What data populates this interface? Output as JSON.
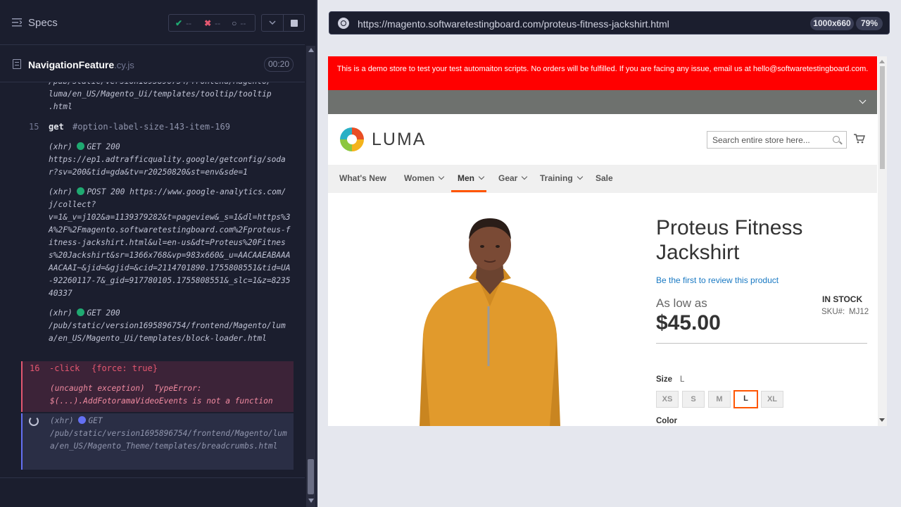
{
  "reporter": {
    "specs_label": "Specs",
    "stats": {
      "passed": "--",
      "failed": "--",
      "pending": "--"
    },
    "spec_file": {
      "name": "NavigationFeature",
      "ext": ".cy.js",
      "duration": "00:20"
    },
    "log": {
      "top_fragment": "/pub/static/version1695896754/frontend/Magento/\nluma/en_US/Magento_Ui/templates/tooltip/tooltip\n.html",
      "cmd15": {
        "num": "15",
        "name": "get",
        "arg": "#option-label-size-143-item-169"
      },
      "xhr1": {
        "prefix": "(xhr)",
        "method": "GET",
        "status": "200",
        "url": "https://ep1.adtrafficquality.google/getconfig/sodar?sv=200&tid=gda&tv=r20250820&st=env&sde=1"
      },
      "xhr2": {
        "prefix": "(xhr)",
        "method": "POST",
        "status": "200",
        "url": "https://www.google-analytics.com/j/collect?\nv=1&_v=j102&a=1139379282&t=pageview&_s=1&dl=https%3A%2F%2Fmagento.softwaretestingboard.com%2Fproteus-fitness-jackshirt.html&ul=en-us&dt=Proteus%20Fitness%20Jackshirt&sr=1366x768&vp=983x660&_u=AACAAEABAAAAACAAI~&jid=&gjid=&cid=2114701890.1755808551&tid=UA-92260117-7&_gid=917780105.1755808551&_slc=1&z=823540337"
      },
      "xhr3": {
        "prefix": "(xhr)",
        "method": "GET",
        "status": "200",
        "url": "/pub/static/version1695896754/frontend/Magento/luma/en_US/Magento_Ui/templates/block-loader.html"
      },
      "cmd16": {
        "num": "16",
        "name": "-click",
        "arg": "{force: true}"
      },
      "error": "(uncaught exception)  TypeError:\n$(...).AddFotoramaVideoEvents is not a function",
      "xhr4": {
        "prefix": "(xhr)",
        "method": "GET",
        "url": "/pub/static/version1695896754/frontend/Magento/luma/en_US/Magento_Theme/templates/breadcrumbs.html"
      }
    }
  },
  "aut": {
    "url": "https://magento.softwaretestingboard.com/proteus-fitness-jackshirt.html",
    "viewport": "1000x660",
    "zoom": "79%",
    "site": {
      "demo_banner": "This is a demo store to test your test automaiton scripts. No orders will be fulfilled. If you are facing any issue, email us at hello@softwaretestingboard.com.",
      "logo_text": "LUMA",
      "search_placeholder": "Search entire store here...",
      "nav": [
        "What's New",
        "Women",
        "Men",
        "Gear",
        "Training",
        "Sale"
      ],
      "product": {
        "title": "Proteus Fitness Jackshirt",
        "review_link": "Be the first to review this product",
        "stock": "IN STOCK",
        "as_low_as": "As low as",
        "price": "$45.00",
        "sku_label": "SKU#:",
        "sku": "MJ12",
        "size_label": "Size",
        "size_value": "L",
        "sizes": [
          "XS",
          "S",
          "M",
          "L",
          "XL"
        ],
        "selected_size": "L",
        "color_label": "Color"
      }
    }
  },
  "colors": {
    "reporter_bg": "#1b1e2e",
    "pass": "#1fa971",
    "fail": "#e45770",
    "pending": "#6470f3",
    "banner_red": "#ff0000",
    "accent_orange": "#ff5501",
    "link_blue": "#1979c3"
  }
}
